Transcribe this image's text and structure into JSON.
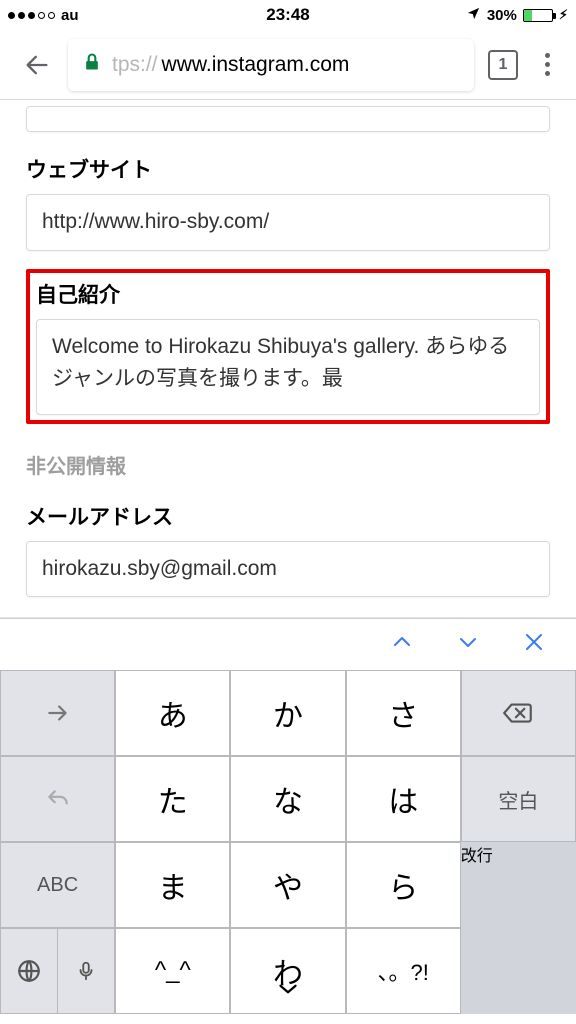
{
  "status_bar": {
    "carrier": "au",
    "time": "23:48",
    "battery_pct": "30%"
  },
  "chrome": {
    "url_protocol": "tps://",
    "url_host": "www.instagram.com",
    "tab_count": "1"
  },
  "form": {
    "website_label": "ウェブサイト",
    "website_value": "http://www.hiro-sby.com/",
    "bio_label": "自己紹介",
    "bio_value": "Welcome to Hirokazu Shibuya's gallery. あらゆるジャンルの写真を撮ります。最",
    "private_label": "非公開情報",
    "email_label": "メールアドレス",
    "email_value": "hirokazu.sby@gmail.com"
  },
  "keyboard": {
    "rows": [
      [
        "→",
        "あ",
        "か",
        "さ",
        "⌫"
      ],
      [
        "↶",
        "た",
        "な",
        "は",
        "空白"
      ],
      [
        "ABC",
        "ま",
        "や",
        "ら"
      ],
      [
        "🌐/🎤",
        "^_^",
        "わ",
        "、。?!"
      ]
    ],
    "return_label": "改行",
    "space_label": "空白"
  }
}
